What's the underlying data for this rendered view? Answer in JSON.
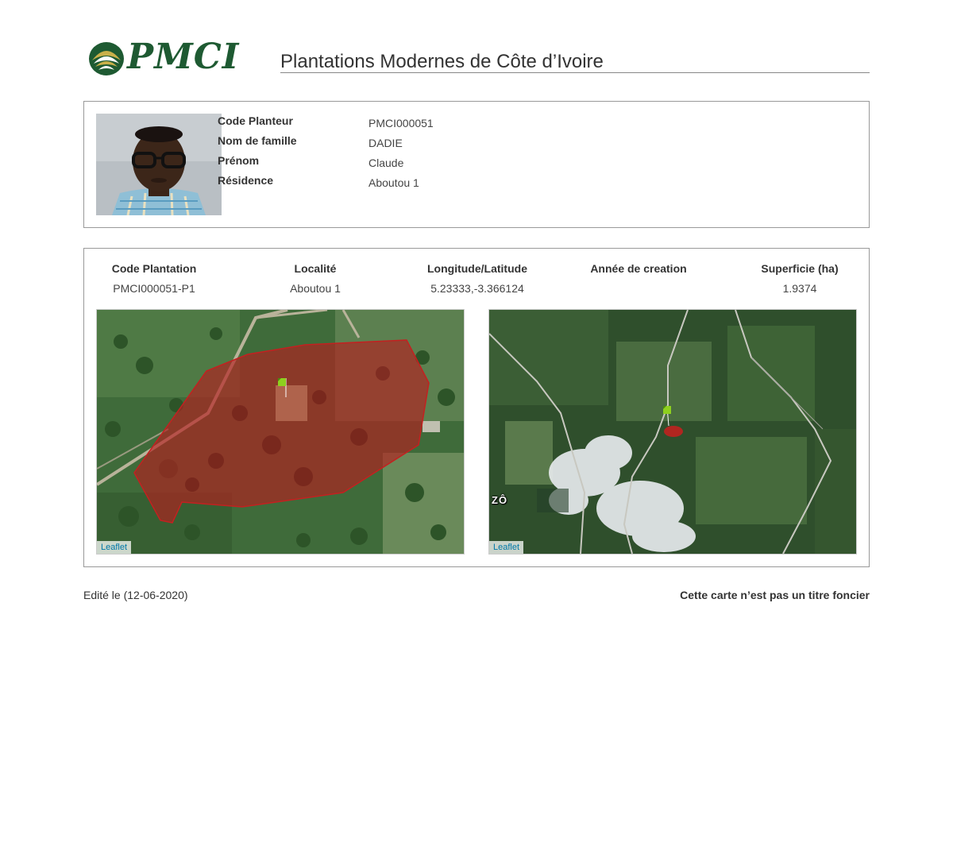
{
  "header": {
    "logo_text": "PMCI",
    "title": "Plantations Modernes de Côte d’Ivoire"
  },
  "planter": {
    "fields": [
      {
        "label": "Code Planteur",
        "value": "PMCI000051"
      },
      {
        "label": "Nom de famille",
        "value": "DADIE"
      },
      {
        "label": "Prénom",
        "value": "Claude"
      },
      {
        "label": "Résidence",
        "value": "Aboutou 1"
      }
    ]
  },
  "plantation": {
    "columns": [
      {
        "header": "Code Plantation",
        "value": "PMCI000051-P1"
      },
      {
        "header": "Localité",
        "value": "Aboutou 1"
      },
      {
        "header": "Longitude/Latitude",
        "value": "5.23333,-3.366124"
      },
      {
        "header": "Année de creation",
        "value": ""
      },
      {
        "header": "Superficie (ha)",
        "value": "1.9374"
      }
    ],
    "maps": [
      {
        "attribution": "Leaflet"
      },
      {
        "attribution": "Leaflet",
        "place_label": "ZÔ"
      }
    ]
  },
  "footer": {
    "edited": "Edité le (12-06-2020)",
    "disclaimer": "Cette carte n’est pas un titre foncier"
  },
  "colors": {
    "brand_green": "#1e5a32",
    "parcel_fill": "#b41e1e",
    "link_blue": "#0078a8"
  }
}
